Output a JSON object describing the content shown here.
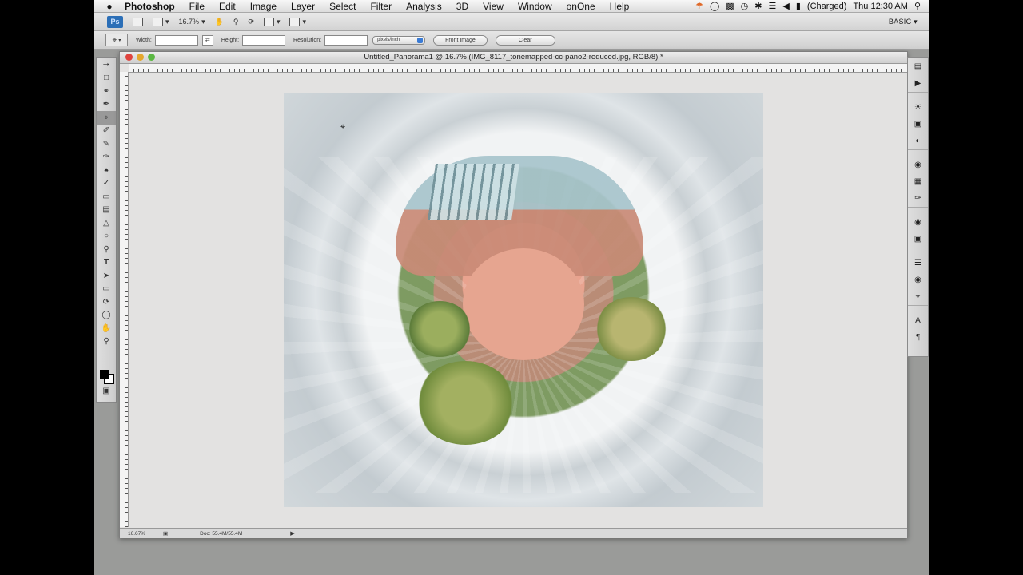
{
  "menubar": {
    "apple_icon": "apple-icon",
    "app_name": "Photoshop",
    "items": [
      "File",
      "Edit",
      "Image",
      "Layer",
      "Select",
      "Filter",
      "Analysis",
      "3D",
      "View",
      "Window",
      "onOne",
      "Help"
    ],
    "battery_text": "(Charged)",
    "clock": "Thu 12:30 AM"
  },
  "appbar": {
    "logo": "Ps",
    "zoom": "16.7%",
    "workspace": "BASIC"
  },
  "options": {
    "width_label": "Width:",
    "height_label": "Height:",
    "resolution_label": "Resolution:",
    "units": "pixels/inch",
    "front_image": "Front Image",
    "clear": "Clear"
  },
  "document": {
    "title": "Untitled_Panorama1 @ 16.7% (IMG_8117_tonemapped-cc-pano2-reduced.jpg, RGB/8) *",
    "status_zoom": "16.67%",
    "status_doc": "Doc: 55.4M/55.4M"
  },
  "colors": {
    "close": "#e0443e",
    "minimize": "#e5a82e",
    "zoom": "#5bb843"
  }
}
